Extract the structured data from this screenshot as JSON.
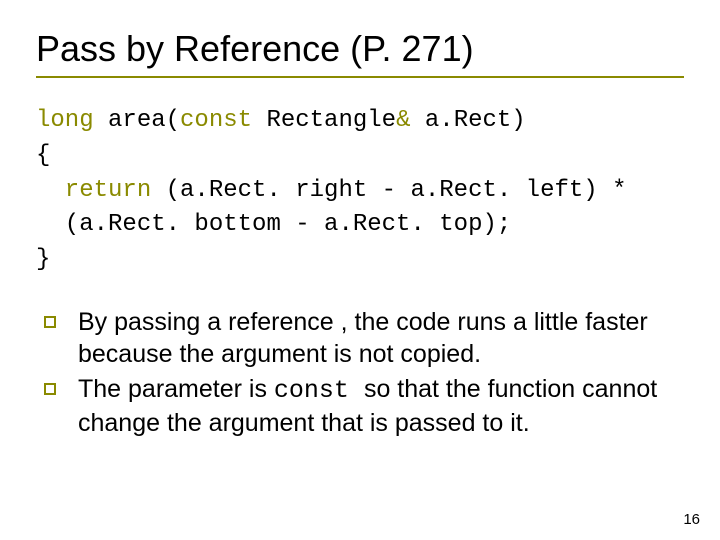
{
  "title": "Pass by Reference (P. 271)",
  "code": {
    "t1": "long",
    "t2": " area(",
    "t3": "const",
    "t4": " Rectangle",
    "t5": "&",
    "t6": " a.Rect)",
    "line2": "{",
    "line3a": "  return",
    "line3b": " (a.Rect. right - a.Rect. left) *",
    "line4": "  (a.Rect. bottom - a.Rect. top);",
    "line5": "}"
  },
  "bullets": [
    {
      "text_a": "By passing a reference , the code runs a little faster because the argument is not copied."
    },
    {
      "text_a": "The parameter is ",
      "code": "const ",
      "text_b": "so that the function cannot change the argument that is passed to it."
    }
  ],
  "page_number": "16"
}
